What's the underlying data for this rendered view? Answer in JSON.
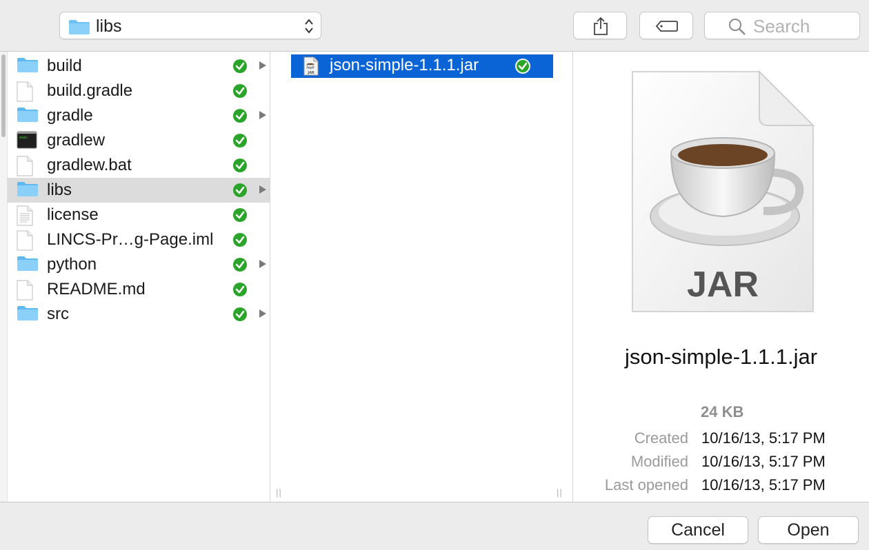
{
  "toolbar": {
    "path_label": "libs",
    "search_placeholder": "Search"
  },
  "sidebar": {
    "items": [
      {
        "label": "build",
        "kind": "folder",
        "has_arrow": true
      },
      {
        "label": "build.gradle",
        "kind": "file",
        "has_arrow": false
      },
      {
        "label": "gradle",
        "kind": "folder",
        "has_arrow": true
      },
      {
        "label": "gradlew",
        "kind": "terminal",
        "has_arrow": false
      },
      {
        "label": "gradlew.bat",
        "kind": "file",
        "has_arrow": false
      },
      {
        "label": "libs",
        "kind": "folder",
        "has_arrow": true,
        "selected": true
      },
      {
        "label": "license",
        "kind": "text",
        "has_arrow": false
      },
      {
        "label": "LINCS-Pr…g-Page.iml",
        "kind": "file",
        "has_arrow": false
      },
      {
        "label": "python",
        "kind": "folder",
        "has_arrow": true
      },
      {
        "label": "README.md",
        "kind": "file",
        "has_arrow": false
      },
      {
        "label": "src",
        "kind": "folder",
        "has_arrow": true
      }
    ]
  },
  "column2": {
    "items": [
      {
        "label": "json-simple-1.1.1.jar",
        "selected": true
      }
    ]
  },
  "preview": {
    "icon_label": "JAR",
    "filename": "json-simple-1.1.1.jar",
    "size": "24 KB",
    "created_label": "Created",
    "created_value": "10/16/13, 5:17 PM",
    "modified_label": "Modified",
    "modified_value": "10/16/13, 5:17 PM",
    "last_opened_label": "Last opened",
    "last_opened_value": "10/16/13, 5:17 PM"
  },
  "buttons": {
    "cancel": "Cancel",
    "open": "Open"
  },
  "colors": {
    "selection_blue": "#0a64d6",
    "sync_green": "#2aa52a",
    "folder_blue": "#6ec2f4"
  }
}
